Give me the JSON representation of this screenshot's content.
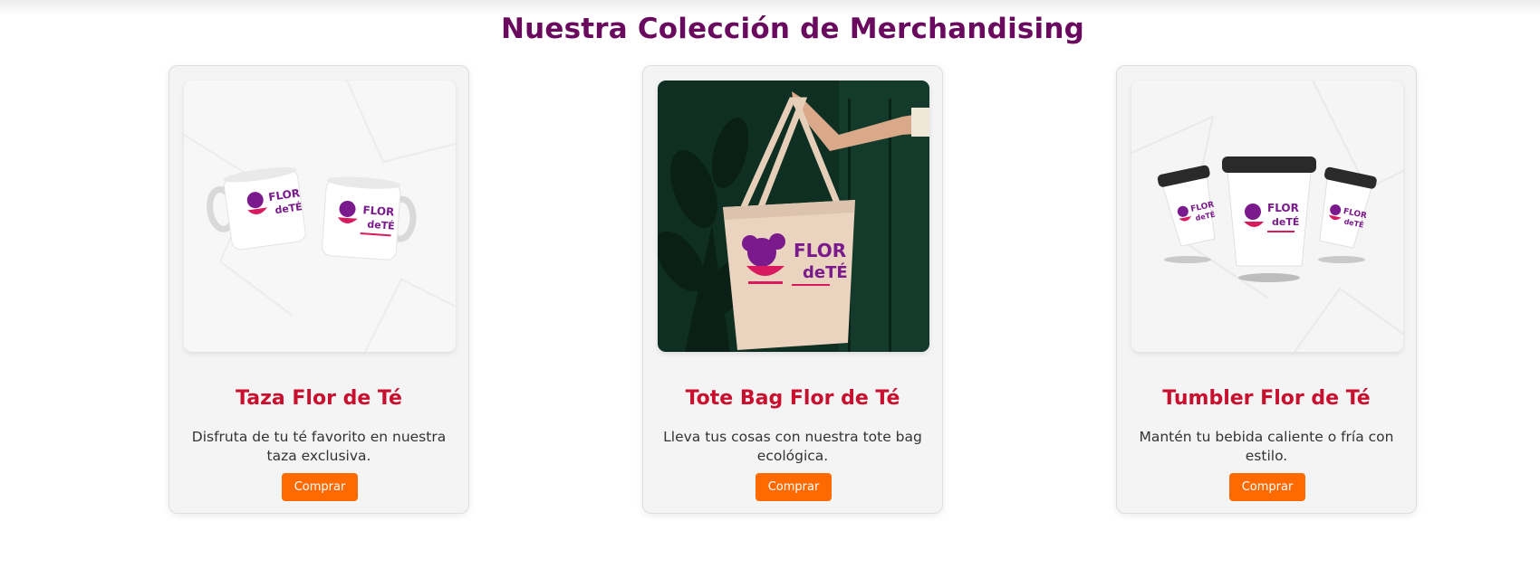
{
  "section": {
    "title": "Nuestra Colección de Merchandising"
  },
  "products": [
    {
      "title": "Taza Flor de Té",
      "description": "Disfruta de tu té favorito en nuestra taza exclusiva.",
      "button_label": "Comprar",
      "image": "mugs-image"
    },
    {
      "title": "Tote Bag Flor de Té",
      "description": "Lleva tus cosas con nuestra tote bag ecológica.",
      "button_label": "Comprar",
      "image": "tote-bag-image"
    },
    {
      "title": "Tumbler Flor de Té",
      "description": "Mantén tu bebida caliente o fría con estilo.",
      "button_label": "Comprar",
      "image": "tumblers-image"
    }
  ],
  "colors": {
    "title": "#6a0a5e",
    "product_title": "#c8102e",
    "button": "#ff6a00",
    "logo_purple": "#7a1a8c",
    "logo_pink": "#d81b60"
  }
}
